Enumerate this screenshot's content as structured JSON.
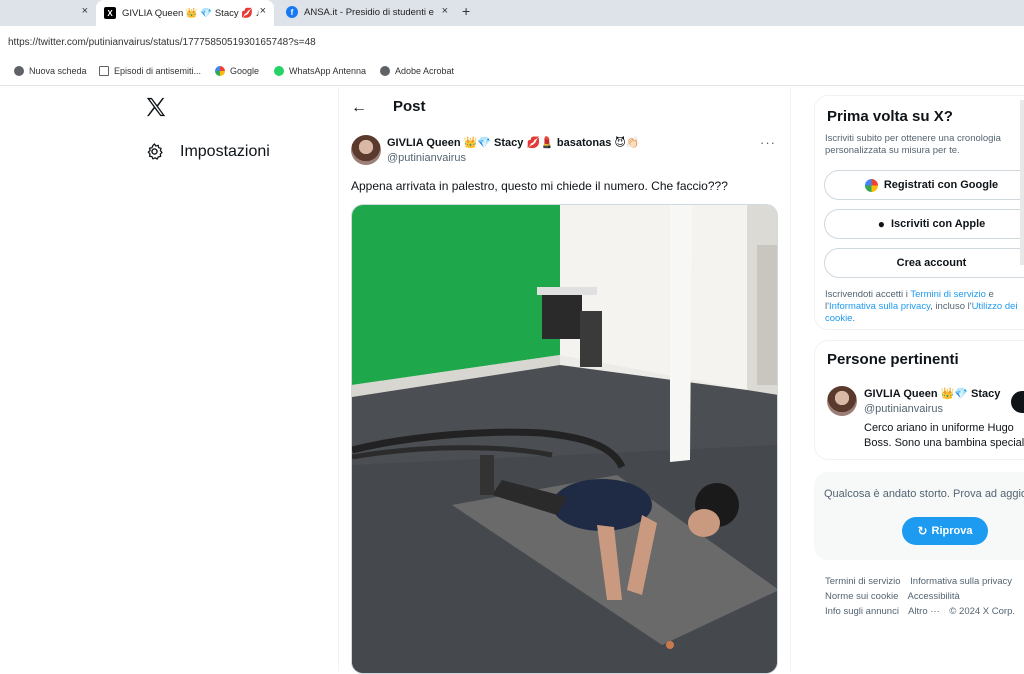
{
  "browser": {
    "tabs": [
      {
        "title": "",
        "close": "×"
      },
      {
        "title": "GIVLIA Queen 👑 💎 Stacy 💋 ♩",
        "close": "×"
      },
      {
        "title": "ANSA.it - Presidio di studenti e",
        "close": "×"
      }
    ],
    "newtab": "+",
    "url": "https://twitter.com/putinianvairus/status/1777585051930165748?s=48",
    "bookmarks": [
      {
        "label": "Nuova scheda",
        "icon": "globe-icon"
      },
      {
        "label": "Episodi di antisemiti...",
        "icon": "doc-icon"
      },
      {
        "label": "Google",
        "icon": "google-icon"
      },
      {
        "label": "WhatsApp Antenna",
        "icon": "whatsapp-icon"
      },
      {
        "label": "Adobe Acrobat",
        "icon": "globe-icon"
      }
    ]
  },
  "nav": {
    "logo": "X",
    "settings_label": "Impostazioni"
  },
  "post": {
    "header_title": "Post",
    "author_name": "GIVLIA Queen 👑💎 Stacy 💋💄 basatonas 😈👏🏻",
    "author_handle": "@putinianvairus",
    "more": "···",
    "text": "Appena arrivata in palestro, questo mi chiede il numero. Che faccio???"
  },
  "sidebar": {
    "signup": {
      "title": "Prima volta su X?",
      "subtitle": "Iscriviti subito per ottenere una cronologia personalizzata su misura per te.",
      "google_label": "Registrati con Google",
      "apple_label": "Iscriviti con Apple",
      "create_label": "Crea account",
      "legal_prefix": "Iscrivendoti accetti i ",
      "legal_terms": "Termini di servizio",
      "legal_and": " e l'",
      "legal_privacy": "Informativa sulla privacy",
      "legal_incl": ", incluso l'",
      "legal_cookie": "Utilizzo dei cookie",
      "legal_end": "."
    },
    "people": {
      "title": "Persone pertinenti",
      "name": "GIVLIA Queen 👑💎 Stacy",
      "handle": "@putinianvairus",
      "bio": "Cerco ariano in uniforme Hugo Boss. Sono una bambina speciale."
    },
    "error": {
      "text": "Qualcosa è andato storto. Prova ad aggiornare.",
      "retry_label": "Riprova"
    },
    "footer": [
      "Termini di servizio",
      "Informativa sulla privacy",
      "Norme sui cookie",
      "Accessibilità",
      "Info sugli annunci",
      "Altro ···",
      "© 2024 X Corp."
    ]
  },
  "colors": {
    "accent": "#1d9bf0",
    "text_primary": "#0f1419",
    "text_secondary": "#536471",
    "green_screen": "#1fa84b"
  }
}
